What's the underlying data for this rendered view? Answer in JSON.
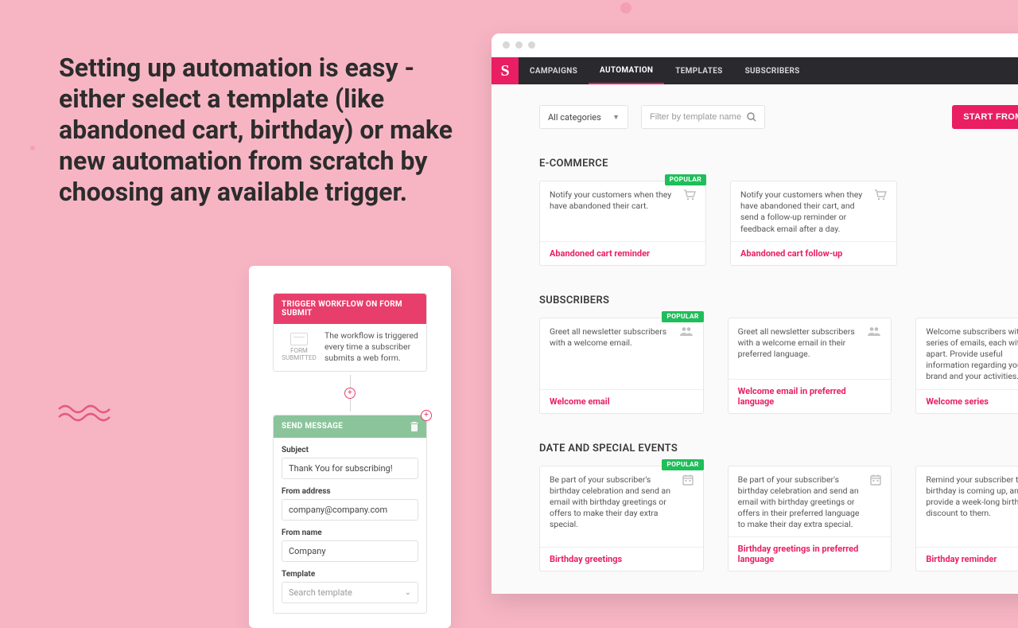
{
  "headline": "Setting up automation is easy - either select a template (like abandoned cart, birthday) or make new automation from scratch by choosing any available trigger.",
  "builder": {
    "trigger": {
      "header": "TRIGGER WORKFLOW ON FORM SUBMIT",
      "icon_label": "FORM SUBMITTED",
      "text": "The workflow is triggered every time a subscriber submits a web form."
    },
    "send": {
      "header": "SEND MESSAGE",
      "fields": {
        "subject": {
          "label": "Subject",
          "value": "Thank You for subscribing!"
        },
        "from_address": {
          "label": "From address",
          "value": "company@company.com"
        },
        "from_name": {
          "label": "From name",
          "value": "Company"
        },
        "template": {
          "label": "Template",
          "placeholder": "Search template"
        }
      }
    }
  },
  "browser": {
    "brand_letter": "S",
    "nav": [
      "CAMPAIGNS",
      "AUTOMATION",
      "TEMPLATES",
      "SUBSCRIBERS"
    ],
    "nav_active": 1,
    "toolbar": {
      "category": "All categories",
      "search_placeholder": "Filter by template name",
      "start_button": "START FROM SCRATCH"
    },
    "sections": [
      {
        "title": "E-COMMERCE",
        "cards": [
          {
            "popular": true,
            "desc": "Notify your customers when they have abandoned their cart.",
            "name": "Abandoned cart reminder",
            "icon": "cart"
          },
          {
            "popular": false,
            "desc": "Notify your customers when they have abandoned their cart, and send a follow-up reminder or feedback email after a day.",
            "name": "Abandoned cart follow-up",
            "icon": "cart"
          }
        ]
      },
      {
        "title": "SUBSCRIBERS",
        "cards": [
          {
            "popular": true,
            "desc": "Greet all newsletter subscribers with a welcome email.",
            "name": "Welcome email",
            "icon": "users"
          },
          {
            "popular": false,
            "desc": "Greet all newsletter subscribers with a welcome email in their preferred language.",
            "name": "Welcome email in preferred language",
            "icon": "users"
          },
          {
            "popular": false,
            "desc": "Welcome subscribers with a series of emails, each with days apart. Provide useful information regarding your brand and your activities.",
            "name": "Welcome series",
            "icon": "users"
          }
        ]
      },
      {
        "title": "DATE AND SPECIAL EVENTS",
        "cards": [
          {
            "popular": true,
            "desc": "Be part of your subscriber's birthday celebration and send an email with birthday greetings or offers to make their day extra special.",
            "name": "Birthday greetings",
            "icon": "calendar"
          },
          {
            "popular": false,
            "desc": "Be part of your subscriber's birthday celebration and send an email with birthday greetings or offers in their preferred language to make their day extra special.",
            "name": "Birthday greetings in preferred language",
            "icon": "calendar"
          },
          {
            "popular": false,
            "desc": "Remind your subscriber their birthday is coming up, and provide a week-long birthday discount to them.",
            "name": "Birthday reminder",
            "icon": "calendar"
          }
        ]
      }
    ],
    "popular_label": "POPULAR"
  }
}
